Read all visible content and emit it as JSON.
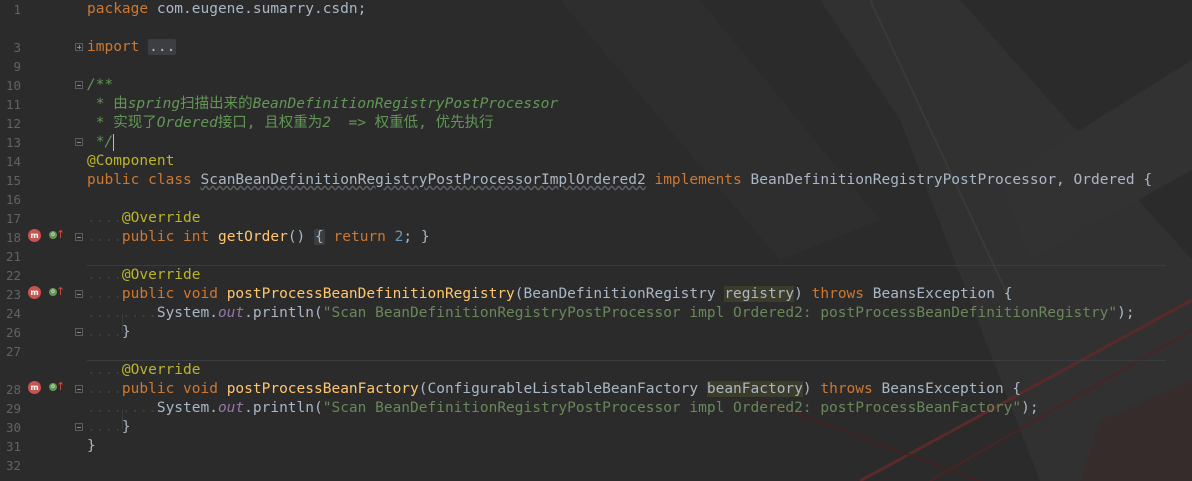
{
  "editor": {
    "theme": "darcula",
    "colors": {
      "background": "#2b2b2b",
      "keyword": "#cc7832",
      "annotation": "#bbb529",
      "string": "#6a8759",
      "number": "#6897bb",
      "doc_comment": "#629755",
      "method": "#ffc66d",
      "field": "#9876aa"
    },
    "line_numbers": [
      "1",
      "3",
      "9",
      "10",
      "11",
      "12",
      "13",
      "14",
      "15",
      "16",
      "17",
      "18",
      "21",
      "22",
      "23",
      "24",
      "26",
      "27",
      "28",
      "29",
      "30",
      "31",
      "32"
    ],
    "gutter_icons": {
      "method_badge": "m",
      "override_badge": "o",
      "override_arrow": "↑"
    },
    "code": {
      "l1_kw": "package",
      "l1_rest": " com.eugene.sumarry.csdn;",
      "l3_kw": "import",
      "l3_fold": "...",
      "l10": "/**",
      "l11_a": " * 由",
      "l11_b": "spring",
      "l11_c": "扫描出来的",
      "l11_d": "BeanDefinitionRegistryPostProcessor",
      "l12_a": " * 实现了",
      "l12_b": "Ordered",
      "l12_c": "接口, 且权重为",
      "l12_d": "2",
      "l12_e": "  => 权重低, 优先执行",
      "l13": " */",
      "l14": "@Component",
      "l15_public": "public",
      "l15_class": "class",
      "l15_name": "ScanBeanDefinitionRegistryPostProcessorImplOrdered2",
      "l15_impl": "implements",
      "l15_rest": "BeanDefinitionRegistryPostProcessor, Ordered {",
      "override": "@Override",
      "l18_pub": "public",
      "l18_int": "int",
      "l18_meth": "getOrder",
      "l18_paren": "()",
      "l18_open": "{",
      "l18_ret": "return",
      "l18_num": "2",
      "l18_close": "; }",
      "l23_pub": "public",
      "l23_void": "void",
      "l23_meth": "postProcessBeanDefinitionRegistry",
      "l23_open": "(BeanDefinitionRegistry ",
      "l23_param": "registry",
      "l23_close": ")",
      "l23_throws": "throws",
      "l23_rest": "BeansException {",
      "l24_sys": "System.",
      "l24_out": "out",
      "l24_print": ".println(",
      "l24_str": "\"Scan BeanDefinitionRegistryPostProcessor impl Ordered2: postProcessBeanDefinitionRegistry\"",
      "l24_end": ");",
      "close_brace": "}",
      "l28_pub": "public",
      "l28_void": "void",
      "l28_meth": "postProcessBeanFactory",
      "l28_open": "(ConfigurableListableBeanFactory ",
      "l28_param": "beanFactory",
      "l28_close": ")",
      "l28_throws": "throws",
      "l28_rest": "BeansException {",
      "l29_str": "\"Scan BeanDefinitionRegistryPostProcessor impl Ordered2: postProcessBeanFactory\"",
      "l29_end": ");",
      "class_close": "}"
    }
  }
}
